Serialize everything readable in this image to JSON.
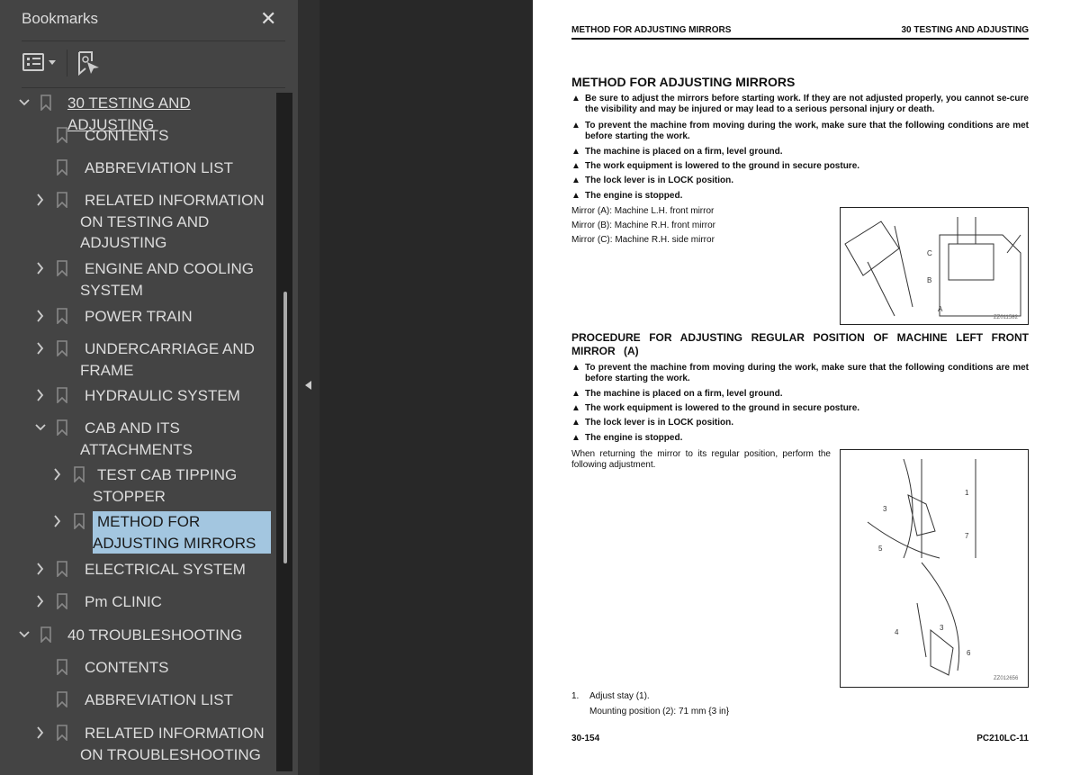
{
  "sidebar": {
    "title": "Bookmarks",
    "close_icon": "close-icon",
    "toolbar": {
      "options_icon": "list-options-icon",
      "find_icon": "find-bookmark-icon"
    },
    "items": [
      {
        "label_lines": [
          "30 TESTING AND ADJUSTING"
        ],
        "level": 0,
        "chevron": "down"
      },
      {
        "label_lines": [
          "CONTENTS"
        ],
        "level": 1,
        "chevron": "none"
      },
      {
        "label_lines": [
          "ABBREVIATION LIST"
        ],
        "level": 1,
        "chevron": "none"
      },
      {
        "label_lines": [
          "RELATED INFORMATION",
          "ON TESTING AND",
          "ADJUSTING"
        ],
        "level": 1,
        "chevron": "right"
      },
      {
        "label_lines": [
          "ENGINE AND COOLING",
          "SYSTEM"
        ],
        "level": 1,
        "chevron": "right"
      },
      {
        "label_lines": [
          "POWER TRAIN"
        ],
        "level": 1,
        "chevron": "right"
      },
      {
        "label_lines": [
          "UNDERCARRIAGE AND",
          "FRAME"
        ],
        "level": 1,
        "chevron": "right"
      },
      {
        "label_lines": [
          "HYDRAULIC SYSTEM"
        ],
        "level": 1,
        "chevron": "right"
      },
      {
        "label_lines": [
          "CAB AND ITS",
          "ATTACHMENTS"
        ],
        "level": 1,
        "chevron": "down"
      },
      {
        "label_lines": [
          "TEST CAB TIPPING",
          "STOPPER"
        ],
        "level": 2,
        "chevron": "right"
      },
      {
        "label_lines": [
          "METHOD FOR",
          "ADJUSTING MIRRORS"
        ],
        "level": 2,
        "chevron": "right",
        "selected": true
      },
      {
        "label_lines": [
          "ELECTRICAL SYSTEM"
        ],
        "level": 1,
        "chevron": "right"
      },
      {
        "label_lines": [
          "Pm CLINIC"
        ],
        "level": 1,
        "chevron": "right"
      },
      {
        "label_lines": [
          "40 TROUBLESHOOTING"
        ],
        "level": 0,
        "chevron": "down"
      },
      {
        "label_lines": [
          "CONTENTS"
        ],
        "level": 1,
        "chevron": "none"
      },
      {
        "label_lines": [
          "ABBREVIATION LIST"
        ],
        "level": 1,
        "chevron": "none"
      },
      {
        "label_lines": [
          "RELATED INFORMATION",
          "ON TROUBLESHOOTING"
        ],
        "level": 1,
        "chevron": "right"
      }
    ]
  },
  "colors": {
    "selected": "#a3c6e0",
    "panel": "#444444"
  },
  "document": {
    "header_left": "METHOD FOR ADJUSTING MIRRORS",
    "header_right": "30 TESTING AND ADJUSTING",
    "title": "METHOD FOR ADJUSTING MIRRORS",
    "warnings1": [
      "Be sure to adjust the mirrors before starting work. If they are not adjusted properly, you cannot se-cure the visibility and may be injured or may lead to a serious personal injury or death.",
      "To prevent the machine from moving during the work, make sure that the following conditions are met before starting the work.",
      "The machine is placed on a firm, level ground.",
      "The work equipment is lowered to the ground in secure posture.",
      "The lock lever is in LOCK position.",
      "The engine is stopped."
    ],
    "mirrors": [
      "Mirror (A): Machine L.H. front mirror",
      "Mirror (B): Machine R.H. front mirror",
      "Mirror (C): Machine R.H. side mirror"
    ],
    "fig1_code": "ZZ011582",
    "subtitle": "PROCEDURE FOR ADJUSTING REGULAR POSITION OF MACHINE LEFT FRONT MIRROR (A)",
    "warnings2": [
      "To prevent the machine from moving during the work, make sure that the following conditions are met before starting the work.",
      "The machine is placed on a firm, level ground.",
      "The work equipment is lowered to the ground in secure posture.",
      "The lock lever is in LOCK position.",
      "The engine is stopped."
    ],
    "intro": "When returning the mirror to its regular position, perform the following adjustment.",
    "fig2_code": "ZZ012656",
    "step_num": "1.",
    "step": "Adjust stay (1).",
    "step_detail": "Mounting position (2): 71 mm {3 in}",
    "footer_left": "30-154",
    "footer_right": "PC210LC-11"
  }
}
